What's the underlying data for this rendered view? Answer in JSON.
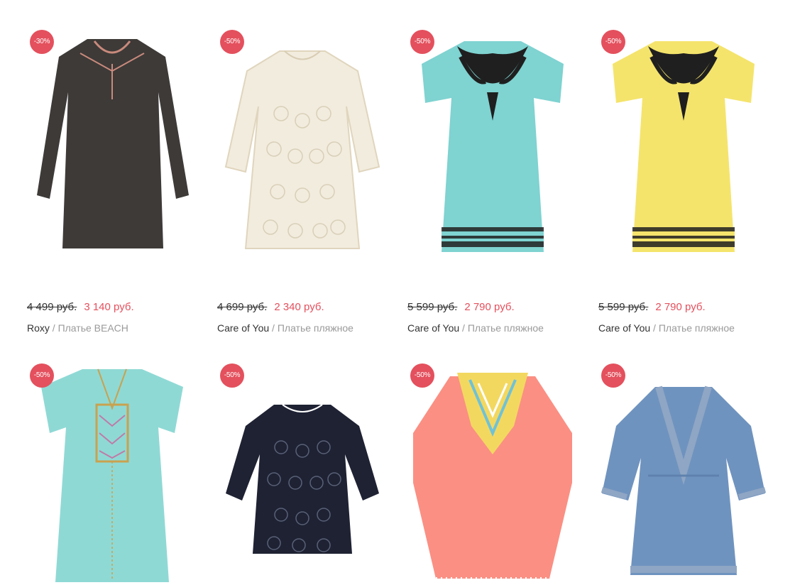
{
  "products": [
    {
      "discount": "-30%",
      "old_price": "4 499 руб.",
      "new_price": "3 140 руб.",
      "brand": "Roxy",
      "separator": " / ",
      "name": "Платье BEACH",
      "color": "#3d3a38",
      "accent": "#c98a7c",
      "style": "long-sleeve-tunic"
    },
    {
      "discount": "-50%",
      "old_price": "4 699 руб.",
      "new_price": "2 340 руб.",
      "brand": "Care of You",
      "separator": " / ",
      "name": "Платье пляжное",
      "color": "#f2ecde",
      "accent": "#e2d8c2",
      "style": "lace-dress"
    },
    {
      "discount": "-50%",
      "old_price": "5 599 руб.",
      "new_price": "2 790 руб.",
      "brand": "Care of You",
      "separator": " / ",
      "name": "Платье пляжное",
      "color": "#7fd3d1",
      "accent": "#1f1f1f",
      "style": "embroidered-dress"
    },
    {
      "discount": "-50%",
      "old_price": "5 599 руб.",
      "new_price": "2 790 руб.",
      "brand": "Care of You",
      "separator": " / ",
      "name": "Платье пляжное",
      "color": "#f4e46c",
      "accent": "#1f1f1f",
      "style": "embroidered-dress"
    },
    {
      "discount": "-50%",
      "color": "#8fd9d5",
      "accent": "#c9a24e",
      "style": "cap-sleeve-tunic"
    },
    {
      "discount": "-50%",
      "color": "#1e2233",
      "accent": "#3a3f55",
      "style": "lace-top"
    },
    {
      "discount": "-50%",
      "color": "#fb8f83",
      "accent": "#f3d860",
      "style": "kaftan"
    },
    {
      "discount": "-50%",
      "color": "#6f93bf",
      "accent": "#8fa6c4",
      "style": "kimono"
    }
  ]
}
